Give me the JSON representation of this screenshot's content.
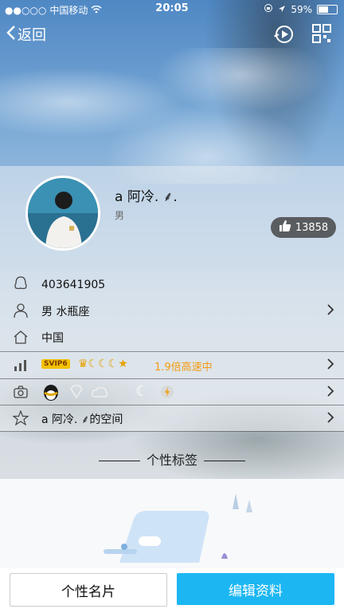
{
  "status": {
    "carrier": "中国移动",
    "time": "20:05",
    "battery": "59%",
    "battery_level": 0.59
  },
  "nav": {
    "back_label": "返回",
    "music_icon": "music-play-icon",
    "qr_icon": "qr-code-icon"
  },
  "profile": {
    "name": "a 阿冷.  ⸙.",
    "gender": "男",
    "likes": "13858"
  },
  "rows": [
    {
      "icon": "penguin-icon",
      "text": "403641905"
    },
    {
      "icon": "person-icon",
      "text": "男 水瓶座"
    },
    {
      "icon": "home-icon",
      "text": "中国"
    },
    {
      "icon": "level-chart-icon",
      "text": "1.9倍高速中",
      "vip_badge": "SVIP6"
    },
    {
      "icon": "camera-icon",
      "text": ""
    },
    {
      "icon": "star-icon",
      "text": "a 阿冷.  ⸙的空间"
    }
  ],
  "tags": {
    "title": "个性标签"
  },
  "buttons": {
    "card_label": "个性名片",
    "edit_label": "编辑资料"
  },
  "colors": {
    "accent": "#1cb7f3",
    "vip_orange": "#f39c12"
  }
}
